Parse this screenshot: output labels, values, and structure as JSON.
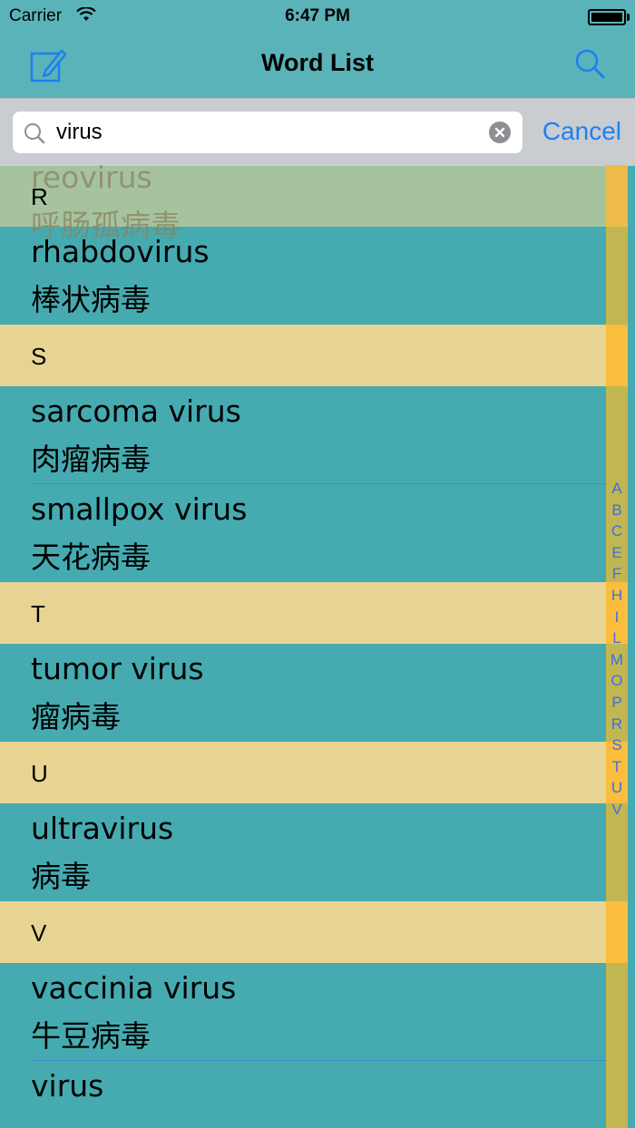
{
  "status": {
    "carrier": "Carrier",
    "time": "6:47 PM"
  },
  "nav": {
    "title": "Word List"
  },
  "search": {
    "query": "virus",
    "cancel": "Cancel"
  },
  "ghost_entry": {
    "word": "reovirus",
    "translation": "呼肠孤病毒"
  },
  "rows": [
    {
      "type": "section",
      "letter": "R"
    },
    {
      "type": "entry",
      "word": "rhabdovirus",
      "translation": "棒状病毒"
    },
    {
      "type": "section",
      "letter": "S"
    },
    {
      "type": "entry",
      "word": "sarcoma virus",
      "translation": "肉瘤病毒"
    },
    {
      "type": "entry",
      "word": "smallpox virus",
      "translation": "天花病毒"
    },
    {
      "type": "section",
      "letter": "T"
    },
    {
      "type": "entry",
      "word": "tumor virus",
      "translation": "瘤病毒"
    },
    {
      "type": "section",
      "letter": "U"
    },
    {
      "type": "entry",
      "word": "ultravirus",
      "translation": "病毒"
    },
    {
      "type": "section",
      "letter": "V"
    },
    {
      "type": "entry",
      "word": "vaccinia virus",
      "translation": "牛豆病毒"
    },
    {
      "type": "entry",
      "word": "virus",
      "translation": ""
    }
  ],
  "index_letters": [
    "A",
    "B",
    "C",
    "E",
    "F",
    "H",
    "I",
    "L",
    "M",
    "O",
    "P",
    "R",
    "S",
    "T",
    "U",
    "V"
  ],
  "colors": {
    "accent": "#1f7ff2",
    "teal": "#45abb1",
    "section": "#e8d492",
    "index": "#3d6fe0"
  }
}
